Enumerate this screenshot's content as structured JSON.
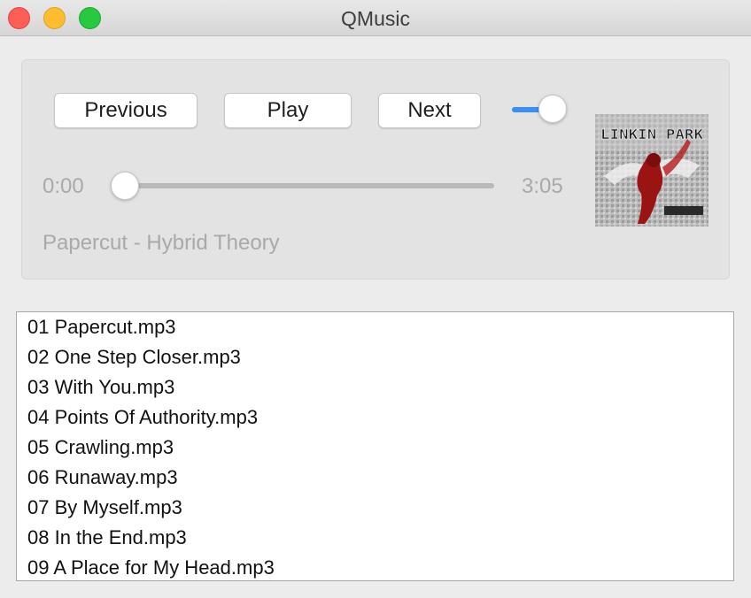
{
  "window": {
    "title": "QMusic"
  },
  "controls": {
    "previous_label": "Previous",
    "play_label": "Play",
    "next_label": "Next",
    "volume": 1.0
  },
  "progress": {
    "current_time": "0:00",
    "total_time": "3:05",
    "fraction": 0.0
  },
  "now_playing": "Papercut - Hybrid Theory",
  "album_art": {
    "text": "LINKIN PARK"
  },
  "playlist": [
    "01 Papercut.mp3",
    "02 One Step Closer.mp3",
    "03 With You.mp3",
    "04 Points Of Authority.mp3",
    "05 Crawling.mp3",
    "06 Runaway.mp3",
    "07 By Myself.mp3",
    "08 In the End.mp3",
    "09 A Place for My Head.mp3"
  ],
  "colors": {
    "accent": "#3a8ef6",
    "close": "#fd5f57",
    "minimize": "#febd2e",
    "maximize": "#28c840"
  }
}
